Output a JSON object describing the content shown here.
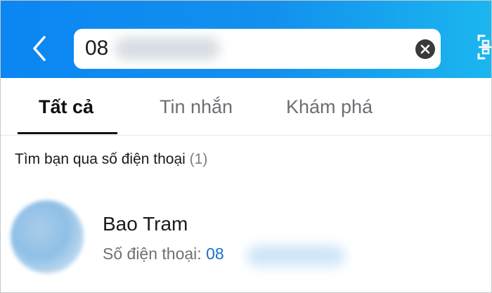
{
  "header": {
    "search": {
      "value": "08",
      "placeholder": ""
    },
    "icons": {
      "back": "chevron-left-icon",
      "clear": "clear-x-icon",
      "qr": "qr-scan-icon"
    },
    "colors": {
      "gradient_start": "#0b86f3",
      "gradient_end": "#1bb6ef"
    }
  },
  "tabs": [
    {
      "label": "Tất cả",
      "active": true
    },
    {
      "label": "Tin nhắn",
      "active": false
    },
    {
      "label": "Khám phá",
      "active": false
    }
  ],
  "section": {
    "title": "Tìm bạn qua số điện thoại",
    "count": "(1)"
  },
  "results": [
    {
      "name": "Bao Tram",
      "phone_label": "Số điện thoại:",
      "phone_value": "08"
    }
  ],
  "accent_color": "#1a73c9"
}
